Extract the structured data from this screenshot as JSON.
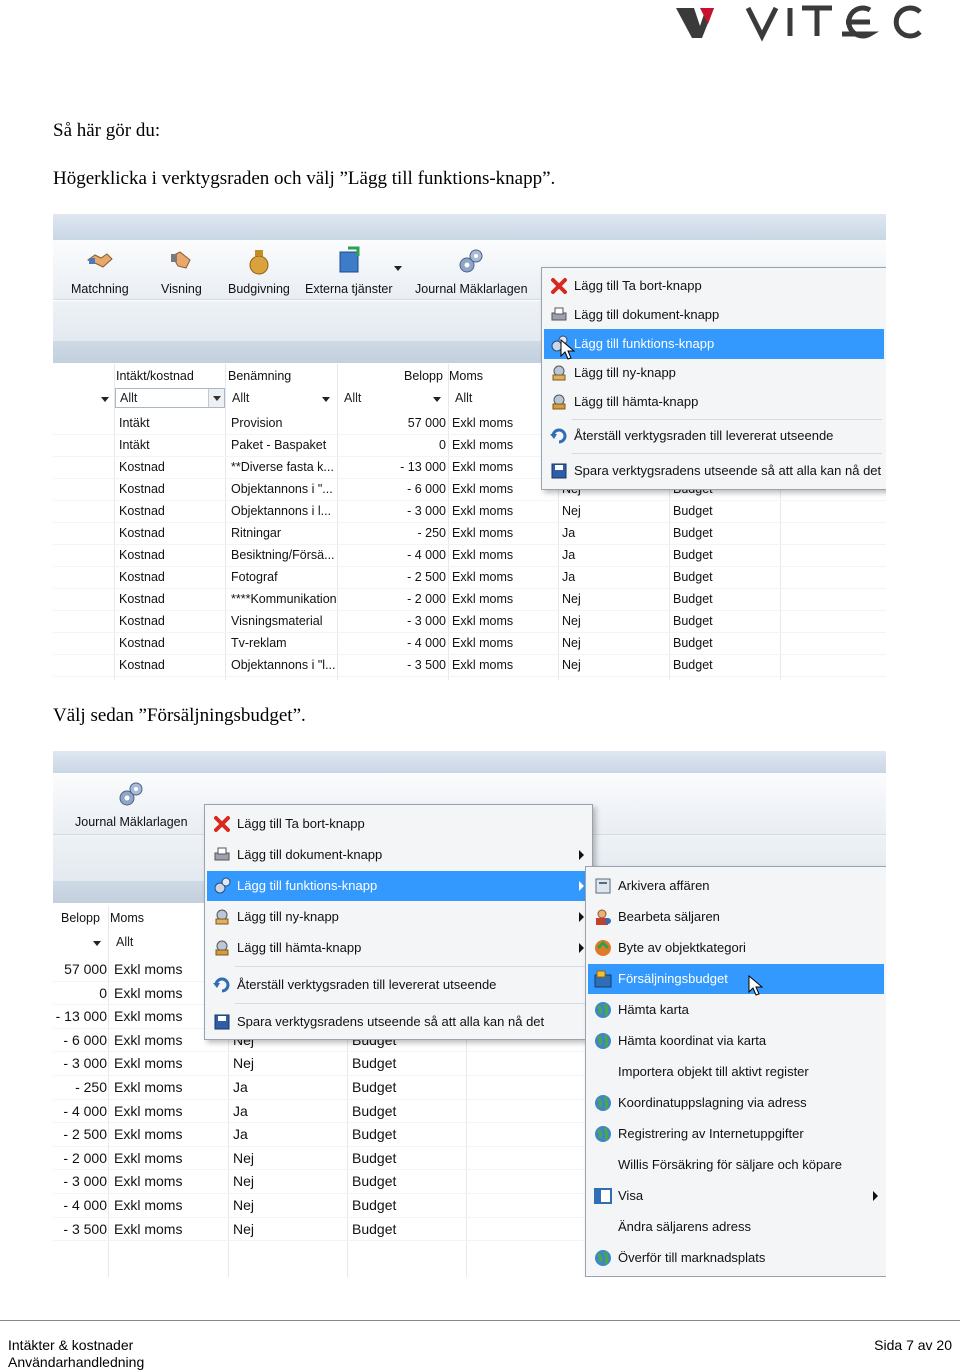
{
  "logo": {
    "text": "VITEC",
    "colors": {
      "mark": "#3a3a3a",
      "accent": "#c8102e"
    }
  },
  "doc": {
    "intro": "Så här gör du:",
    "step1": "Högerklicka i verktygsraden och välj ”Lägg till funktions-knapp”.",
    "step2": "Välj sedan ”Försäljningsbudget”."
  },
  "shot1": {
    "toolbar": [
      {
        "label": "Matchning",
        "icon": "handshake-icon"
      },
      {
        "label": "Visning",
        "icon": "hand-icon"
      },
      {
        "label": "Budgivning",
        "icon": "money-bag-icon"
      },
      {
        "label": "Externa tjänster",
        "icon": "server-icon"
      },
      {
        "label": "Journal Mäklarlagen",
        "icon": "gears-icon"
      }
    ],
    "columns": {
      "intakt": "Intäkt/kostnad",
      "benamning": "Benämning",
      "belopp": "Belopp",
      "moms": "Moms"
    },
    "filters": {
      "f1": "Allt",
      "f2": "Allt",
      "f3": "Allt",
      "f4": "Allt"
    },
    "rows": [
      [
        "Intäkt",
        "Provision",
        "57 000",
        "Exkl moms",
        "",
        ""
      ],
      [
        "Intäkt",
        "Paket - Baspaket",
        "0",
        "Exkl moms",
        "",
        ""
      ],
      [
        "Kostnad",
        "**Diverse fasta k...",
        "- 13 000",
        "Exkl moms",
        "",
        ""
      ],
      [
        "Kostnad",
        "Objektannons i \"...",
        "- 6 000",
        "Exkl moms",
        "Nej",
        "Budget"
      ],
      [
        "Kostnad",
        "Objektannons i l...",
        "- 3 000",
        "Exkl moms",
        "Nej",
        "Budget"
      ],
      [
        "Kostnad",
        "Ritningar",
        "- 250",
        "Exkl moms",
        "Ja",
        "Budget"
      ],
      [
        "Kostnad",
        "Besiktning/Försä...",
        "- 4 000",
        "Exkl moms",
        "Ja",
        "Budget"
      ],
      [
        "Kostnad",
        "Fotograf",
        "- 2 500",
        "Exkl moms",
        "Ja",
        "Budget"
      ],
      [
        "Kostnad",
        "****Kommunikation",
        "- 2 000",
        "Exkl moms",
        "Nej",
        "Budget"
      ],
      [
        "Kostnad",
        "Visningsmaterial",
        "- 3 000",
        "Exkl moms",
        "Nej",
        "Budget"
      ],
      [
        "Kostnad",
        "Tv-reklam",
        "- 4 000",
        "Exkl moms",
        "Nej",
        "Budget"
      ],
      [
        "Kostnad",
        "Objektannons i \"l...",
        "- 3 500",
        "Exkl moms",
        "Nej",
        "Budget"
      ]
    ],
    "menu": [
      {
        "label": "Lägg till Ta bort-knapp",
        "icon": "red-x-icon"
      },
      {
        "label": "Lägg till dokument-knapp",
        "icon": "printer-icon"
      },
      {
        "label": "Lägg till funktions-knapp",
        "icon": "gears-icon",
        "selected": true
      },
      {
        "label": "Lägg till ny-knapp",
        "icon": "new-item-icon"
      },
      {
        "label": "Lägg till hämta-knapp",
        "icon": "fetch-icon"
      },
      {
        "label": "Återställ verktygsraden till levererat utseende",
        "icon": "reset-icon"
      },
      {
        "label": "Spara verktygsradens utseende så att alla kan nå det",
        "icon": "floppy-icon"
      }
    ]
  },
  "shot2": {
    "toolbar": [
      {
        "label": "Journal Mäklarlagen",
        "icon": "gears-icon"
      }
    ],
    "columns": {
      "belopp": "Belopp",
      "moms": "Moms"
    },
    "filters": {
      "f1": "Allt"
    },
    "rows": [
      [
        "57 000",
        "Exkl moms",
        "",
        ""
      ],
      [
        "0",
        "Exkl moms",
        "",
        ""
      ],
      [
        "- 13 000",
        "Exkl moms",
        "",
        ""
      ],
      [
        "- 6 000",
        "Exkl moms",
        "Nej",
        "Budget"
      ],
      [
        "- 3 000",
        "Exkl moms",
        "Nej",
        "Budget"
      ],
      [
        "- 250",
        "Exkl moms",
        "Ja",
        "Budget"
      ],
      [
        "- 4 000",
        "Exkl moms",
        "Ja",
        "Budget"
      ],
      [
        "- 2 500",
        "Exkl moms",
        "Ja",
        "Budget"
      ],
      [
        "- 2 000",
        "Exkl moms",
        "Nej",
        "Budget"
      ],
      [
        "- 3 000",
        "Exkl moms",
        "Nej",
        "Budget"
      ],
      [
        "- 4 000",
        "Exkl moms",
        "Nej",
        "Budget"
      ],
      [
        "- 3 500",
        "Exkl moms",
        "Nej",
        "Budget"
      ]
    ],
    "menu": [
      {
        "label": "Lägg till Ta bort-knapp",
        "icon": "red-x-icon",
        "submenu": false
      },
      {
        "label": "Lägg till dokument-knapp",
        "icon": "printer-icon",
        "submenu": true
      },
      {
        "label": "Lägg till funktions-knapp",
        "icon": "gears-icon",
        "submenu": true,
        "selected": true
      },
      {
        "label": "Lägg till ny-knapp",
        "icon": "new-item-icon",
        "submenu": true
      },
      {
        "label": "Lägg till hämta-knapp",
        "icon": "fetch-icon",
        "submenu": true
      },
      {
        "label": "Återställ verktygsraden till levererat utseende",
        "icon": "reset-icon",
        "submenu": false
      },
      {
        "label": "Spara verktygsradens utseende så att alla kan nå det",
        "icon": "floppy-icon",
        "submenu": false
      }
    ],
    "submenu": [
      {
        "label": "Arkivera affären",
        "icon": "archive-icon"
      },
      {
        "label": "Bearbeta säljaren",
        "icon": "person-icon"
      },
      {
        "label": "Byte av objektkategori",
        "icon": "swap-icon"
      },
      {
        "label": "Försäljningsbudget",
        "icon": "budget-icon",
        "selected": true
      },
      {
        "label": "Hämta karta",
        "icon": "globe-icon"
      },
      {
        "label": "Hämta koordinat via karta",
        "icon": "globe-icon"
      },
      {
        "label": "Importera objekt till aktivt register",
        "icon": ""
      },
      {
        "label": "Koordinatuppslagning via adress",
        "icon": "globe-icon"
      },
      {
        "label": "Registrering av Internetuppgifter",
        "icon": "globe-icon"
      },
      {
        "label": "Willis Försäkring för säljare och köpare",
        "icon": ""
      },
      {
        "label": "Visa",
        "icon": "window-icon",
        "submenu": true
      },
      {
        "label": "Ändra säljarens adress",
        "icon": ""
      },
      {
        "label": "Överför till marknadsplats",
        "icon": "globe-icon"
      }
    ]
  },
  "footer": {
    "line1": "Intäkter & kostnader",
    "line2": "Användarhandledning",
    "page": "Sida 7 av 20"
  }
}
